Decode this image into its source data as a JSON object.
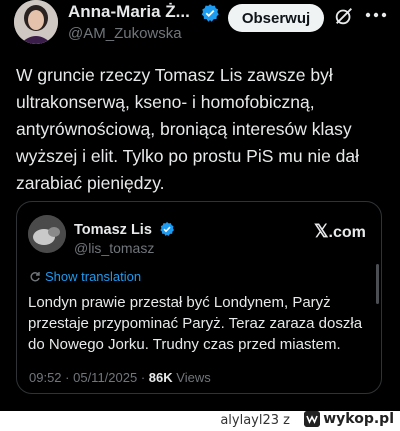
{
  "post": {
    "author_name": "Anna-Maria Ż...",
    "handle": "@AM_Zukowska",
    "follow_label": "Obserwuj",
    "text": "W gruncie rzeczy Tomasz Lis zawsze był\nultrakonserwą, kseno- i homofobiczną,\nantyrównościową, broniącą interesów klasy\nwyższej i elit. Tylko po prostu PiS mu nie dał\nzarabiać pieniędzy."
  },
  "quote": {
    "author_name": "Tomasz Lis",
    "handle": "@lis_tomasz",
    "brand": ".com",
    "translate_label": "Show translation",
    "text": "Londyn prawie przestał być Londynem, Paryż\nprzestaje  przypominać Paryż. Teraz zaraza doszła\ndo Nowego Jorku. Trudny czas przed miastem.",
    "time": "09:52",
    "date": "05/11/2025",
    "views_count": "86K",
    "views_label": "Views"
  },
  "footer": {
    "username": "alylayl23",
    "separator": "z",
    "site": "wykop.pl"
  },
  "colors": {
    "background": "#000000",
    "text": "#e7e9ea",
    "muted": "#71767b",
    "accent": "#1d9bf0"
  },
  "icons": [
    "verified-badge-icon",
    "grok-icon",
    "more-icon",
    "x-logo-icon",
    "translate-icon",
    "wykop-logo-icon"
  ]
}
